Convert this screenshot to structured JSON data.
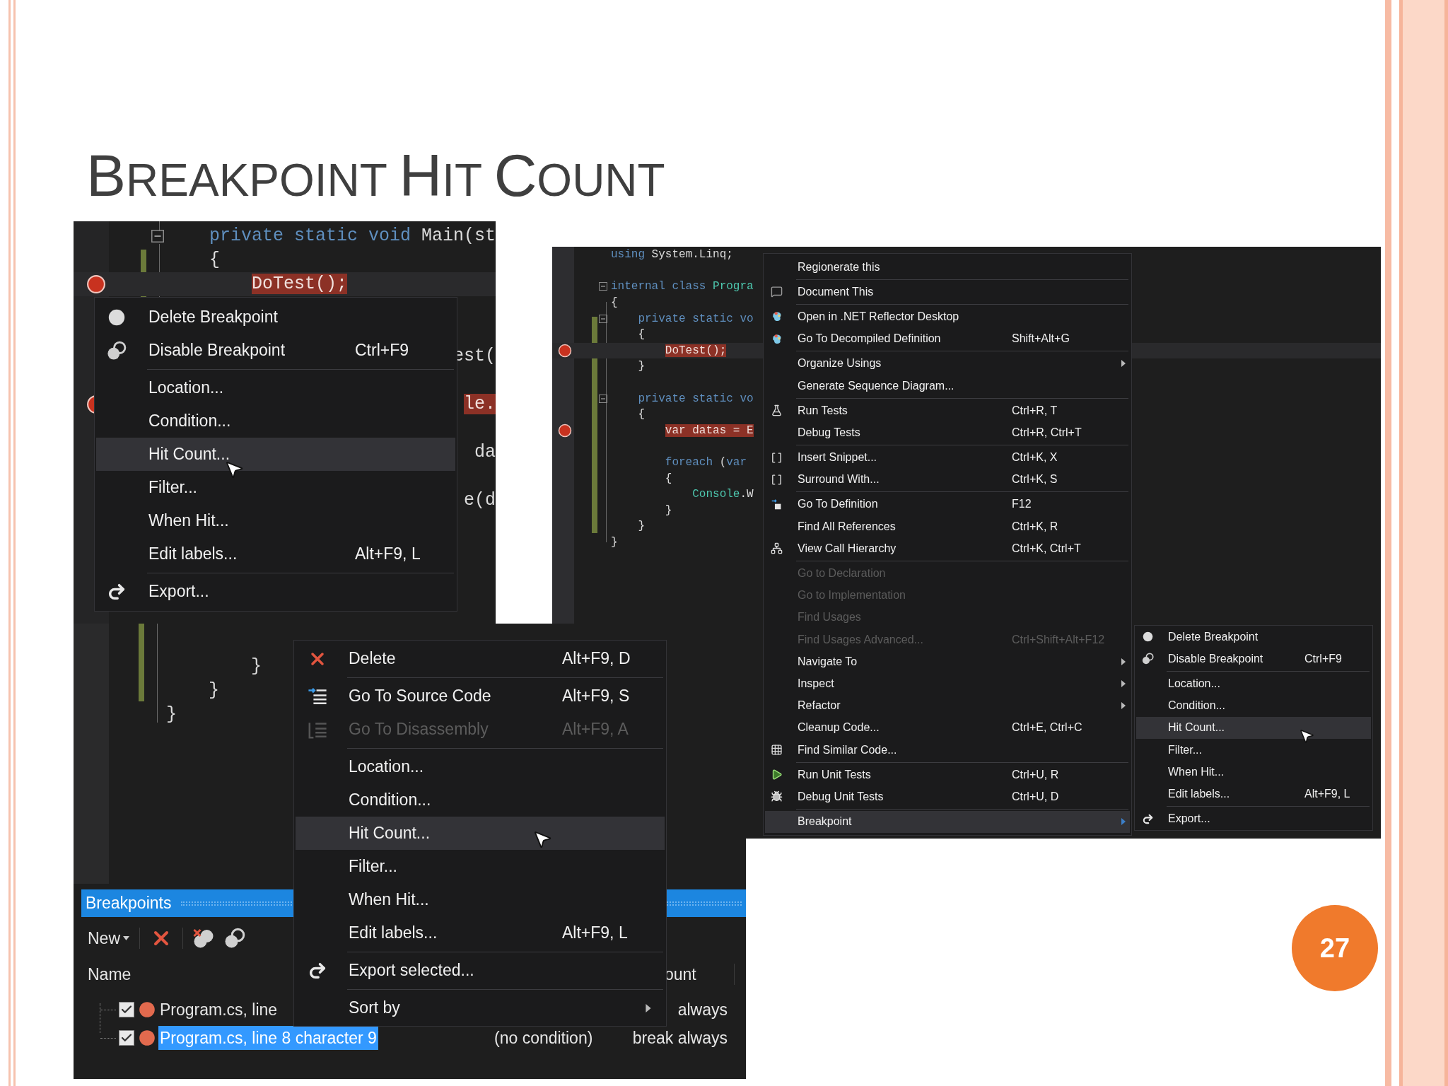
{
  "slide": {
    "title": "BREAKPOINT HIT COUNT",
    "page_number": "27"
  },
  "screenshot_editor": {
    "code_lines": [
      {
        "kind": "code",
        "segments": [
          {
            "text": "private static void ",
            "kind": "keyword"
          },
          {
            "text": "Main(st",
            "kind": "plain"
          }
        ],
        "current": false,
        "breakpoint": false,
        "foldable": true
      },
      {
        "kind": "code",
        "segments": [
          {
            "text": "{",
            "kind": "plain"
          }
        ],
        "current": false,
        "breakpoint": false,
        "foldable": false
      },
      {
        "kind": "code",
        "segments": [
          {
            "text": "    DoTest();",
            "kind": "breakpoint"
          }
        ],
        "current": true,
        "breakpoint": true,
        "foldable": false
      },
      {
        "kind": "blank"
      },
      {
        "kind": "blank"
      },
      {
        "kind": "code",
        "segments": [
          {
            "text": "                        est(",
            "kind": "plain"
          }
        ]
      },
      {
        "kind": "blank"
      },
      {
        "kind": "code",
        "segments": [
          {
            "text": "                        le.",
            "kind": "breakpoint"
          }
        ],
        "breakpoint": true
      },
      {
        "kind": "blank"
      },
      {
        "kind": "code",
        "segments": [
          {
            "text": "                         da",
            "kind": "plain"
          }
        ]
      },
      {
        "kind": "blank"
      },
      {
        "kind": "code",
        "segments": [
          {
            "text": "                        e(d",
            "kind": "plain"
          }
        ]
      }
    ],
    "menu": {
      "items": [
        {
          "kind": "item",
          "label": "Delete Breakpoint",
          "selected": false
        },
        {
          "kind": "item",
          "label": "Disable Breakpoint",
          "shortcut": "Ctrl+F9",
          "selected": false
        },
        {
          "kind": "separator"
        },
        {
          "kind": "item",
          "label": "Location...",
          "selected": false
        },
        {
          "kind": "item",
          "label": "Condition...",
          "selected": false
        },
        {
          "kind": "item",
          "label": "Hit Count...",
          "selected": true
        },
        {
          "kind": "item",
          "label": "Filter...",
          "selected": false
        },
        {
          "kind": "item",
          "label": "When Hit...",
          "selected": false
        },
        {
          "kind": "item",
          "label": "Edit labels...",
          "shortcut": "Alt+F9, L",
          "selected": false
        },
        {
          "kind": "separator"
        },
        {
          "kind": "item",
          "label": "Export...",
          "selected": false
        }
      ]
    }
  },
  "screenshot_breakpoints": {
    "code_lines": [
      {
        "kind": "code",
        "segments": [
          {
            "text": "        }",
            "kind": "plain"
          }
        ]
      },
      {
        "kind": "code",
        "segments": [
          {
            "text": "    }",
            "kind": "plain"
          }
        ]
      },
      {
        "kind": "code",
        "segments": [
          {
            "text": "}",
            "kind": "plain"
          }
        ]
      }
    ],
    "panel": {
      "title": "Breakpoints",
      "new_label": "New",
      "columns": [
        "Name",
        "ount"
      ],
      "rows": [
        {
          "checked": true,
          "selected": false,
          "name": "Program.cs, line",
          "hit_count": "always"
        },
        {
          "checked": true,
          "selected": true,
          "name": "Program.cs, line 8 character 9",
          "condition": "(no condition)",
          "hit_count": "break always"
        }
      ]
    },
    "menu": {
      "items": [
        {
          "kind": "item",
          "label": "Delete",
          "shortcut": "Alt+F9, D",
          "selected": false,
          "disabled": false,
          "submenu": false
        },
        {
          "kind": "separator"
        },
        {
          "kind": "item",
          "label": "Go To Source Code",
          "shortcut": "Alt+F9, S",
          "selected": false,
          "disabled": false,
          "submenu": false
        },
        {
          "kind": "item",
          "label": "Go To Disassembly",
          "shortcut": "Alt+F9, A",
          "selected": false,
          "disabled": true,
          "submenu": false
        },
        {
          "kind": "separator"
        },
        {
          "kind": "item",
          "label": "Location...",
          "selected": false,
          "disabled": false,
          "submenu": false
        },
        {
          "kind": "item",
          "label": "Condition...",
          "selected": false,
          "disabled": false,
          "submenu": false
        },
        {
          "kind": "item",
          "label": "Hit Count...",
          "selected": true,
          "disabled": false,
          "submenu": false
        },
        {
          "kind": "item",
          "label": "Filter...",
          "selected": false,
          "disabled": false,
          "submenu": false
        },
        {
          "kind": "item",
          "label": "When Hit...",
          "selected": false,
          "disabled": false,
          "submenu": false
        },
        {
          "kind": "item",
          "label": "Edit labels...",
          "shortcut": "Alt+F9, L",
          "selected": false,
          "disabled": false,
          "submenu": false
        },
        {
          "kind": "separator"
        },
        {
          "kind": "item",
          "label": "Export selected...",
          "selected": false,
          "disabled": false,
          "submenu": false
        },
        {
          "kind": "separator"
        },
        {
          "kind": "item",
          "label": "Sort by",
          "selected": false,
          "disabled": false,
          "submenu": true
        }
      ]
    }
  },
  "screenshot_resharper": {
    "code_lines": [
      {
        "kind": "code",
        "segments": [
          {
            "text": "using",
            "kind": "keyword"
          },
          {
            "text": " System.Linq;",
            "kind": "plain"
          }
        ],
        "current": false,
        "breakpoint": false,
        "foldable": false
      },
      {
        "kind": "blank"
      },
      {
        "kind": "code",
        "segments": [
          {
            "text": "internal class ",
            "kind": "keyword"
          },
          {
            "text": "Progra",
            "kind": "type"
          }
        ],
        "current": false,
        "breakpoint": false,
        "foldable": true
      },
      {
        "kind": "code",
        "segments": [
          {
            "text": "{",
            "kind": "plain"
          }
        ],
        "current": false,
        "breakpoint": false,
        "foldable": false
      },
      {
        "kind": "code",
        "segments": [
          {
            "text": "    private static vo",
            "kind": "keyword"
          }
        ],
        "current": false,
        "breakpoint": false,
        "foldable": true
      },
      {
        "kind": "code",
        "segments": [
          {
            "text": "    {",
            "kind": "plain"
          }
        ],
        "current": false,
        "breakpoint": false,
        "foldable": false
      },
      {
        "kind": "code",
        "segments": [
          {
            "text": "        DoTest();",
            "kind": "breakpoint"
          }
        ],
        "current": true,
        "breakpoint": true,
        "foldable": false
      },
      {
        "kind": "code",
        "segments": [
          {
            "text": "    }",
            "kind": "plain"
          }
        ],
        "current": false,
        "breakpoint": false,
        "foldable": false
      },
      {
        "kind": "blank"
      },
      {
        "kind": "code",
        "segments": [
          {
            "text": "    private static vo",
            "kind": "keyword"
          }
        ],
        "current": false,
        "breakpoint": false,
        "foldable": true
      },
      {
        "kind": "code",
        "segments": [
          {
            "text": "    {",
            "kind": "plain"
          }
        ],
        "current": false,
        "breakpoint": false,
        "foldable": false
      },
      {
        "kind": "code",
        "segments": [
          {
            "text": "        var datas = E",
            "kind": "breakpoint"
          }
        ],
        "current": false,
        "breakpoint": true,
        "foldable": false
      },
      {
        "kind": "blank"
      },
      {
        "kind": "code",
        "segments": [
          {
            "text": "        foreach",
            "kind": "keyword"
          },
          {
            "text": " (",
            "kind": "plain"
          },
          {
            "text": "var",
            "kind": "keyword"
          }
        ],
        "current": false,
        "breakpoint": false,
        "foldable": false
      },
      {
        "kind": "code",
        "segments": [
          {
            "text": "        {",
            "kind": "plain"
          }
        ],
        "current": false,
        "breakpoint": false,
        "foldable": false
      },
      {
        "kind": "code",
        "segments": [
          {
            "text": "            Console",
            "kind": "type"
          },
          {
            "text": ".W",
            "kind": "plain"
          }
        ],
        "current": false,
        "breakpoint": false,
        "foldable": false
      },
      {
        "kind": "code",
        "segments": [
          {
            "text": "        }",
            "kind": "plain"
          }
        ],
        "current": false,
        "breakpoint": false,
        "foldable": false
      },
      {
        "kind": "code",
        "segments": [
          {
            "text": "    }",
            "kind": "plain"
          }
        ],
        "current": false,
        "breakpoint": false,
        "foldable": false
      },
      {
        "kind": "code",
        "segments": [
          {
            "text": "}",
            "kind": "plain"
          }
        ],
        "current": false,
        "breakpoint": false,
        "foldable": false
      }
    ],
    "menu": {
      "items": [
        {
          "kind": "item",
          "label": "Regionerate this",
          "selected": false,
          "disabled": false,
          "submenu": false
        },
        {
          "kind": "separator"
        },
        {
          "kind": "item",
          "label": "Document This",
          "selected": false,
          "disabled": false,
          "submenu": false
        },
        {
          "kind": "separator"
        },
        {
          "kind": "item",
          "label": "Open in .NET Reflector Desktop",
          "selected": false,
          "disabled": false,
          "submenu": false
        },
        {
          "kind": "item",
          "label": "Go To Decompiled Definition",
          "shortcut": "Shift+Alt+G",
          "selected": false,
          "disabled": false,
          "submenu": false
        },
        {
          "kind": "separator"
        },
        {
          "kind": "item",
          "label": "Organize Usings",
          "selected": false,
          "disabled": false,
          "submenu": true
        },
        {
          "kind": "item",
          "label": "Generate Sequence Diagram...",
          "selected": false,
          "disabled": false,
          "submenu": false
        },
        {
          "kind": "separator"
        },
        {
          "kind": "item",
          "label": "Run Tests",
          "shortcut": "Ctrl+R, T",
          "selected": false,
          "disabled": false,
          "submenu": false
        },
        {
          "kind": "item",
          "label": "Debug Tests",
          "shortcut": "Ctrl+R, Ctrl+T",
          "selected": false,
          "disabled": false,
          "submenu": false
        },
        {
          "kind": "separator"
        },
        {
          "kind": "item",
          "label": "Insert Snippet...",
          "shortcut": "Ctrl+K, X",
          "selected": false,
          "disabled": false,
          "submenu": false
        },
        {
          "kind": "item",
          "label": "Surround With...",
          "shortcut": "Ctrl+K, S",
          "selected": false,
          "disabled": false,
          "submenu": false
        },
        {
          "kind": "separator"
        },
        {
          "kind": "item",
          "label": "Go To Definition",
          "shortcut": "F12",
          "selected": false,
          "disabled": false,
          "submenu": false
        },
        {
          "kind": "item",
          "label": "Find All References",
          "shortcut": "Ctrl+K, R",
          "selected": false,
          "disabled": false,
          "submenu": false
        },
        {
          "kind": "item",
          "label": "View Call Hierarchy",
          "shortcut": "Ctrl+K, Ctrl+T",
          "selected": false,
          "disabled": false,
          "submenu": false
        },
        {
          "kind": "separator"
        },
        {
          "kind": "item",
          "label": "Go to Declaration",
          "selected": false,
          "disabled": true,
          "submenu": false
        },
        {
          "kind": "item",
          "label": "Go to Implementation",
          "selected": false,
          "disabled": true,
          "submenu": false
        },
        {
          "kind": "item",
          "label": "Find Usages",
          "selected": false,
          "disabled": true,
          "submenu": false
        },
        {
          "kind": "item",
          "label": "Find Usages Advanced...",
          "shortcut": "Ctrl+Shift+Alt+F12",
          "selected": false,
          "disabled": true,
          "submenu": false
        },
        {
          "kind": "item",
          "label": "Navigate To",
          "selected": false,
          "disabled": false,
          "submenu": true
        },
        {
          "kind": "item",
          "label": "Inspect",
          "selected": false,
          "disabled": false,
          "submenu": true
        },
        {
          "kind": "item",
          "label": "Refactor",
          "selected": false,
          "disabled": false,
          "submenu": true
        },
        {
          "kind": "item",
          "label": "Cleanup Code...",
          "shortcut": "Ctrl+E, Ctrl+C",
          "selected": false,
          "disabled": false,
          "submenu": false
        },
        {
          "kind": "item",
          "label": "Find Similar Code...",
          "selected": false,
          "disabled": false,
          "submenu": false
        },
        {
          "kind": "separator"
        },
        {
          "kind": "item",
          "label": "Run Unit Tests",
          "shortcut": "Ctrl+U, R",
          "selected": false,
          "disabled": false,
          "submenu": false
        },
        {
          "kind": "item",
          "label": "Debug Unit Tests",
          "shortcut": "Ctrl+U, D",
          "selected": false,
          "disabled": false,
          "submenu": false
        },
        {
          "kind": "separator"
        },
        {
          "kind": "item",
          "label": "Breakpoint",
          "selected": true,
          "disabled": false,
          "submenu": true
        }
      ]
    },
    "submenu": {
      "items": [
        {
          "kind": "item",
          "label": "Delete Breakpoint",
          "selected": false
        },
        {
          "kind": "item",
          "label": "Disable Breakpoint",
          "shortcut": "Ctrl+F9",
          "selected": false
        },
        {
          "kind": "separator"
        },
        {
          "kind": "item",
          "label": "Location...",
          "selected": false
        },
        {
          "kind": "item",
          "label": "Condition...",
          "selected": false
        },
        {
          "kind": "item",
          "label": "Hit Count...",
          "selected": true
        },
        {
          "kind": "item",
          "label": "Filter...",
          "selected": false
        },
        {
          "kind": "item",
          "label": "When Hit...",
          "selected": false
        },
        {
          "kind": "item",
          "label": "Edit labels...",
          "shortcut": "Alt+F9, L",
          "selected": false
        },
        {
          "kind": "separator"
        },
        {
          "kind": "item",
          "label": "Export...",
          "selected": false
        }
      ]
    }
  }
}
